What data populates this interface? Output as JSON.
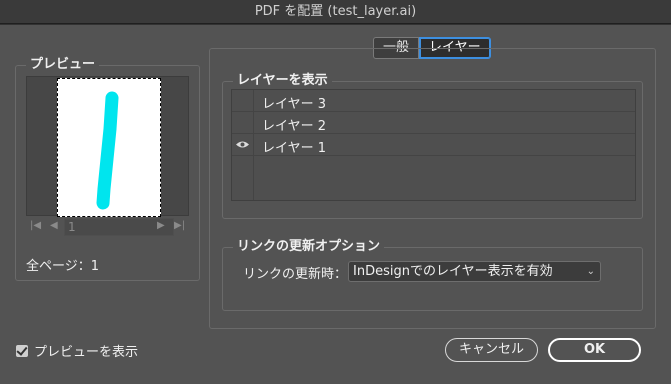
{
  "window": {
    "title": "PDF を配置 (test_layer.ai)"
  },
  "preview": {
    "label": "プレビュー",
    "page_field": "1",
    "page_count": "全ページ：1",
    "stroke_color": "#00e5ee"
  },
  "tabs": [
    {
      "label": "一般",
      "active": false
    },
    {
      "label": "レイヤー",
      "active": true
    }
  ],
  "layers": {
    "label": "レイヤーを表示",
    "items": [
      {
        "name": "レイヤー 3",
        "visible": false
      },
      {
        "name": "レイヤー 2",
        "visible": false
      },
      {
        "name": "レイヤー 1",
        "visible": true
      }
    ]
  },
  "link_update": {
    "label": "リンクの更新オプション",
    "field_label": "リンクの更新時：",
    "selected": "InDesignでのレイヤー表示を有効"
  },
  "show_preview": {
    "label": "プレビューを表示",
    "checked": true
  },
  "buttons": {
    "cancel": "キャンセル",
    "ok": "OK"
  }
}
